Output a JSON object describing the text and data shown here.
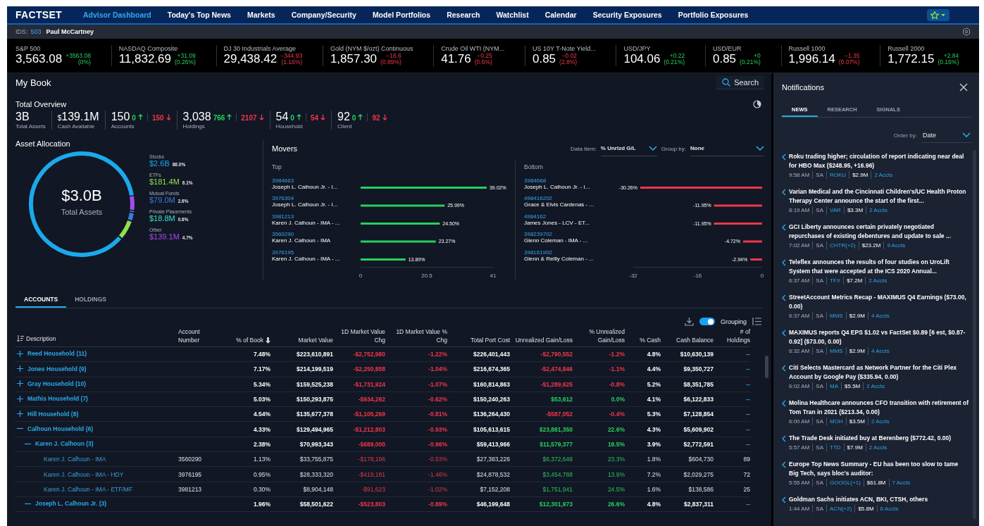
{
  "nav": {
    "logo": "FACTSET",
    "items": [
      {
        "label": "Advisor Dashboard",
        "selected": true
      },
      {
        "label": "Today's Top News",
        "selected": false
      },
      {
        "label": "Markets",
        "selected": false
      },
      {
        "label": "Company/Security",
        "selected": false
      },
      {
        "label": "Model Portfolios",
        "selected": false
      },
      {
        "label": "Research",
        "selected": false
      },
      {
        "label": "Watchlist",
        "selected": false
      },
      {
        "label": "Calendar",
        "selected": false
      },
      {
        "label": "Security Exposures",
        "selected": false
      },
      {
        "label": "Portfolio Exposures",
        "selected": false
      }
    ]
  },
  "ids_bar": {
    "label": "IDS:",
    "id": "503",
    "name": "Paul McCartney"
  },
  "tickers": [
    {
      "name": "S&P 500",
      "value": "3,563.08",
      "change": "+3563.08",
      "percent": "(0%)",
      "positive": true
    },
    {
      "name": "NASDAQ Composite",
      "value": "11,832.69",
      "change": "+31.09",
      "percent": "(0.26%)",
      "positive": true
    },
    {
      "name": "DJ 30 Industrials Average",
      "value": "29,438.42",
      "change": "−344.93",
      "percent": "(1.16%)",
      "positive": false
    },
    {
      "name": "Gold (NYM $/ozt) Continuous",
      "value": "1,857.30",
      "change": "−16.6",
      "percent": "(0.89%)",
      "positive": false
    },
    {
      "name": "Crude Oil WTI (NYM...",
      "value": "41.76",
      "change": "−0.25",
      "percent": "(0.6%)",
      "positive": false
    },
    {
      "name": "US 10Y T-Note Yield...",
      "value": "0.85",
      "change": "−0.02",
      "percent": "(2.8%)",
      "positive": false
    },
    {
      "name": "USD/JPY",
      "value": "104.06",
      "change": "+0.22",
      "percent": "(0.21%)",
      "positive": true
    },
    {
      "name": "USD/EUR",
      "value": "0.85",
      "change": "+0",
      "percent": "(0.21%)",
      "positive": true
    },
    {
      "name": "Russell 1000",
      "value": "1,996.14",
      "change": "−1.35",
      "percent": "(0.07%)",
      "positive": false
    },
    {
      "name": "Russell 2000",
      "value": "1,772.15",
      "change": "+2.84",
      "percent": "(0.16%)",
      "positive": true
    }
  ],
  "my_book": {
    "title": "My Book",
    "search": "Search"
  },
  "overview": {
    "title": "Total Overview",
    "stats": [
      {
        "value": "3B",
        "label": "Total Assets"
      },
      {
        "prefix": "$",
        "value": "139.1M",
        "label": "Cash Available"
      },
      {
        "value": "150",
        "up": "0",
        "down": "150",
        "label": "Accounts"
      },
      {
        "value": "3,038",
        "up": "766",
        "down": "2107",
        "label": "Holdings"
      },
      {
        "value": "54",
        "up": "0",
        "down": "54",
        "label": "Household"
      },
      {
        "value": "92",
        "up": "0",
        "down": "92",
        "label": "Client"
      }
    ]
  },
  "asset_allocation": {
    "title": "Asset Allocation",
    "total": "$3.0B",
    "total_label": "Total Assets",
    "items": [
      {
        "label": "Stocks",
        "value": "$2.6B",
        "percent": "86.0%",
        "level": 0.86,
        "color": "#1ba9ec"
      },
      {
        "label": "ETFs",
        "value": "$181.4M",
        "percent": "6.1%",
        "level": 0.061,
        "color": "#8fe04e"
      },
      {
        "label": "Mutual Funds",
        "value": "$79.0M",
        "percent": "2.6%",
        "level": 0.026,
        "color": "#3d79e0"
      },
      {
        "label": "Private Placements",
        "value": "$18.8M",
        "percent": "0.6%",
        "level": 0.006,
        "color": "#35e3cf"
      },
      {
        "label": "Other",
        "value": "$139.1M",
        "percent": "4.7%",
        "level": 0.047,
        "color": "#a64bf0"
      }
    ]
  },
  "movers": {
    "title": "Movers",
    "data_item_label": "Data Item:",
    "data_item": "% Unrlzd G/L",
    "group_by_label": "Group by:",
    "group_by": "None",
    "top": {
      "title": "Top",
      "ids": [
        "3984663",
        "3976304",
        "3981213",
        "3560290",
        "3976195"
      ],
      "chart_data": {
        "type": "bar",
        "orientation": "horizontal",
        "categories": [
          "Joseph L. Calhoun Jr. - I...",
          "Joseph L. Calhoun Jr. - I...",
          "Karen J. Calhoun - IMA - ...",
          "Karen J. Calhoun - IMA",
          "Karen J. Calhoun - IMA - ..."
        ],
        "values": [
          39.02,
          25.99,
          24.5,
          23.27,
          13.89
        ],
        "xlim": [
          0,
          41
        ],
        "xticks": [
          {
            "value": 0,
            "label": "0"
          },
          {
            "value": 20.5,
            "label": "20.5"
          },
          {
            "value": 41,
            "label": "41"
          }
        ],
        "value_labels": [
          "39.02%",
          "25.99%",
          "24.50%",
          "23.27%",
          "13.89%"
        ]
      }
    },
    "bottom": {
      "title": "Bottom",
      "ids": [
        "3984668",
        "498416202",
        "4984162",
        "398239702",
        "398161902"
      ],
      "chart_data": {
        "type": "bar",
        "orientation": "horizontal",
        "categories": [
          "Joseph L. Calhoun Jr. - I...",
          "Grace & Elvis Cardenas - ...",
          "James Jones - LCV - ET...",
          "Glenn Coleman - IMA  - ...",
          "Glenn & Reilly Coleman - ..."
        ],
        "values": [
          -30.26,
          -11.95,
          -11.95,
          -4.72,
          -2.94
        ],
        "xlim": [
          -32,
          0
        ],
        "xticks": [
          {
            "value": -32,
            "label": "-32"
          },
          {
            "value": -16,
            "label": "-16"
          },
          {
            "value": 0,
            "label": "0"
          }
        ],
        "value_labels": [
          "-30.26%",
          "-11.95%",
          "-11.95%",
          "-4.72%",
          "-2.94%"
        ]
      }
    }
  },
  "table_tabs": [
    {
      "label": "ACCOUNTS",
      "selected": true
    },
    {
      "label": "HOLDINGS",
      "selected": false
    }
  ],
  "table_toolbar": {
    "grouping": {
      "label": "Grouping",
      "on": true
    }
  },
  "table": {
    "columns": [
      "Description",
      "Account Number",
      "% of Book",
      "Market Value",
      "1D Market Value Chg",
      "1D Market Value % Chg",
      "Total Port Cost",
      "Unrealized Gain/Loss",
      "% Unrealized Gain/Loss",
      "% Cash",
      "Cash Balance",
      "# of Holdings"
    ],
    "rows": [
      {
        "kind": "group",
        "expanded": false,
        "day_up": false,
        "gain_up": false,
        "cells": [
          "Reed Household (11)",
          "",
          "7.48%",
          "$223,610,891",
          "-$2,752,980",
          "-1.22%",
          "$226,401,443",
          "-$2,790,552",
          "-1.2%",
          "4.8%",
          "$10,630,139",
          "--"
        ]
      },
      {
        "kind": "group",
        "expanded": false,
        "day_up": false,
        "gain_up": false,
        "cells": [
          "Jones Household (9)",
          "",
          "7.17%",
          "$214,199,519",
          "-$2,250,858",
          "-1.04%",
          "$216,674,365",
          "-$2,474,846",
          "-1.1%",
          "4.4%",
          "$9,350,727",
          "--"
        ]
      },
      {
        "kind": "group",
        "expanded": false,
        "day_up": false,
        "gain_up": false,
        "cells": [
          "Gray Household (10)",
          "",
          "5.34%",
          "$159,525,238",
          "-$1,731,924",
          "-1.07%",
          "$160,814,863",
          "-$1,289,625",
          "-0.8%",
          "5.2%",
          "$8,351,785",
          "--"
        ]
      },
      {
        "kind": "group",
        "expanded": false,
        "day_up": false,
        "gain_up": true,
        "cells": [
          "Mathis Household (7)",
          "",
          "5.03%",
          "$150,293,875",
          "-$934,262",
          "-0.62%",
          "$150,240,263",
          "$53,612",
          "0.0%",
          "4.1%",
          "$6,122,833",
          "--"
        ]
      },
      {
        "kind": "group",
        "expanded": false,
        "day_up": false,
        "gain_up": false,
        "cells": [
          "Hill Household (8)",
          "",
          "4.54%",
          "$135,677,378",
          "-$1,105,269",
          "-0.81%",
          "$136,264,430",
          "-$587,052",
          "-0.4%",
          "5.3%",
          "$7,128,854",
          "--"
        ]
      },
      {
        "kind": "group",
        "expanded": true,
        "day_up": false,
        "gain_up": true,
        "cells": [
          "Calhoun Household (6)",
          "",
          "4.33%",
          "$129,494,965",
          "-$1,212,803",
          "-0.93%",
          "$105,613,615",
          "$23,881,350",
          "22.6%",
          "4.3%",
          "$5,609,902",
          "--"
        ],
        "children": [
          {
            "kind": "group",
            "expanded": true,
            "day_up": false,
            "gain_up": true,
            "cells": [
              "Karen J. Calhoun (3)",
              "",
              "2.38%",
              "$70,993,343",
              "-$689,000",
              "-0.96%",
              "$59,413,966",
              "$11,579,377",
              "19.5%",
              "3.9%",
              "$2,772,591",
              "--"
            ],
            "children": [
              {
                "kind": "account",
                "day_up": false,
                "gain_up": true,
                "cells": [
                  "Karen J. Calhoun - IMA",
                  "3560290",
                  "1.13%",
                  "$33,755,875",
                  "-$178,196",
                  "-0.53%",
                  "$27,383,226",
                  "$6,372,648",
                  "23.3%",
                  "1.8%",
                  "$604,730",
                  "89"
                ]
              },
              {
                "kind": "account",
                "day_up": false,
                "gain_up": true,
                "cells": [
                  "Karen J. Calhoun - IMA - HDY",
                  "3976195",
                  "0.95%",
                  "$28,333,320",
                  "-$419,181",
                  "-1.46%",
                  "$24,878,532",
                  "$3,454,788",
                  "13.9%",
                  "7.2%",
                  "$2,029,275",
                  "72"
                ]
              },
              {
                "kind": "account",
                "day_up": false,
                "gain_up": true,
                "cells": [
                  "Karen J. Calhoun - IMA - ETF/MF",
                  "3981213",
                  "0.30%",
                  "$8,904,148",
                  "-$91,623",
                  "-1.02%",
                  "$7,152,208",
                  "$1,751,941",
                  "24.5%",
                  "1.6%",
                  "$138,586",
                  "25"
                ]
              }
            ]
          },
          {
            "kind": "group",
            "expanded": true,
            "day_up": false,
            "gain_up": true,
            "cells": [
              "Joseph L. Calhoun Jr. (3)",
              "",
              "1.96%",
              "$58,501,622",
              "-$523,803",
              "-0.89%",
              "$46,199,648",
              "$12,301,973",
              "26.6%",
              "4.8%",
              "$2,837,311",
              "--"
            ]
          }
        ]
      }
    ]
  },
  "notifications": {
    "title": "Notifications",
    "tabs": [
      {
        "label": "NEWS",
        "selected": true
      },
      {
        "label": "RESEARCH",
        "selected": false
      },
      {
        "label": "SIGNALS",
        "selected": false
      }
    ],
    "order_by_label": "Order by:",
    "order_by": "Date",
    "items": [
      {
        "headline": "Roku trading higher; circulation of report indicating near deal for HBO Max ($248.95, +16.96)",
        "time": "9:58 AM",
        "source": "SA",
        "ticker": "ROKU",
        "amount": "$2.9M",
        "accounts": "2 Accts"
      },
      {
        "headline": "Varian Medical and the Cincinnati Children's/UC Health Proton Therapy Center announce the start of the first...",
        "time": "8:19 AM",
        "source": "SA",
        "ticker": "VAR",
        "amount": "$3.3M",
        "accounts": "2 Accts"
      },
      {
        "headline": "GCI Liberty announces certain privately negotiated repurchases of existing debentures and update to sale ...",
        "time": "7:02 AM",
        "source": "SA",
        "ticker": "CHTR(+2)",
        "amount": "$23.2M",
        "accounts": "9 Accts"
      },
      {
        "headline": "Teleflex announces the results of four studies on UroLift System that were accepted at the ICS 2020 Annual...",
        "time": "6:37 AM",
        "source": "SA",
        "ticker": "TFX",
        "amount": "$7.2M",
        "accounts": "2 Accts"
      },
      {
        "headline": "StreetAccount Metrics Recap - MAXIMUS Q4 Earnings ($73.00, 0.00)",
        "time": "6:37 AM",
        "source": "SA",
        "ticker": "MMS",
        "amount": "$2.9M",
        "accounts": "4 Accts"
      },
      {
        "headline": "MAXIMUS reports Q4 EPS $1.02 vs FactSet $0.89 [6 est, $0.87-0.92] ($73.00, 0.00)",
        "time": "6:32 AM",
        "source": "SA",
        "ticker": "MMS",
        "amount": "$2.9M",
        "accounts": "4 Accts"
      },
      {
        "headline": "Citi Selects Mastercard as Network Partner for the Citi Plex Account by Google Pay ($335.94, 0.00)",
        "time": "6:02 AM",
        "source": "SA",
        "ticker": "MA",
        "amount": "$5.5M",
        "accounts": "2 Accts"
      },
      {
        "headline": "Molina Healthcare announces CFO transition with retirement of Tom Tran in 2021 ($213.34, 0.00)",
        "time": "6:00 AM",
        "source": "SA",
        "ticker": "MOH",
        "amount": "$3.5M",
        "accounts": "2 Accts"
      },
      {
        "headline": "The Trade Desk initiated buy at Berenberg ($772.42, 0.00)",
        "time": "5:57 AM",
        "source": "SA",
        "ticker": "TTD",
        "amount": "$7.9M",
        "accounts": "2 Accts"
      },
      {
        "headline": "Europe Top News Summary - EU has been too slow to tame Big Tech, says bloc's auditor:",
        "time": "5:55 AM",
        "source": "SA",
        "ticker": "GOOGL(+1)",
        "amount": "$61.8M",
        "accounts": "7 Accts"
      },
      {
        "headline": "Goldman Sachs initiates ACN, BKI, CTSH, others",
        "time": "1:44 AM",
        "source": "SA",
        "ticker": "ACN(+2)",
        "amount": "$5.8M",
        "accounts": "6 Accts"
      }
    ]
  }
}
